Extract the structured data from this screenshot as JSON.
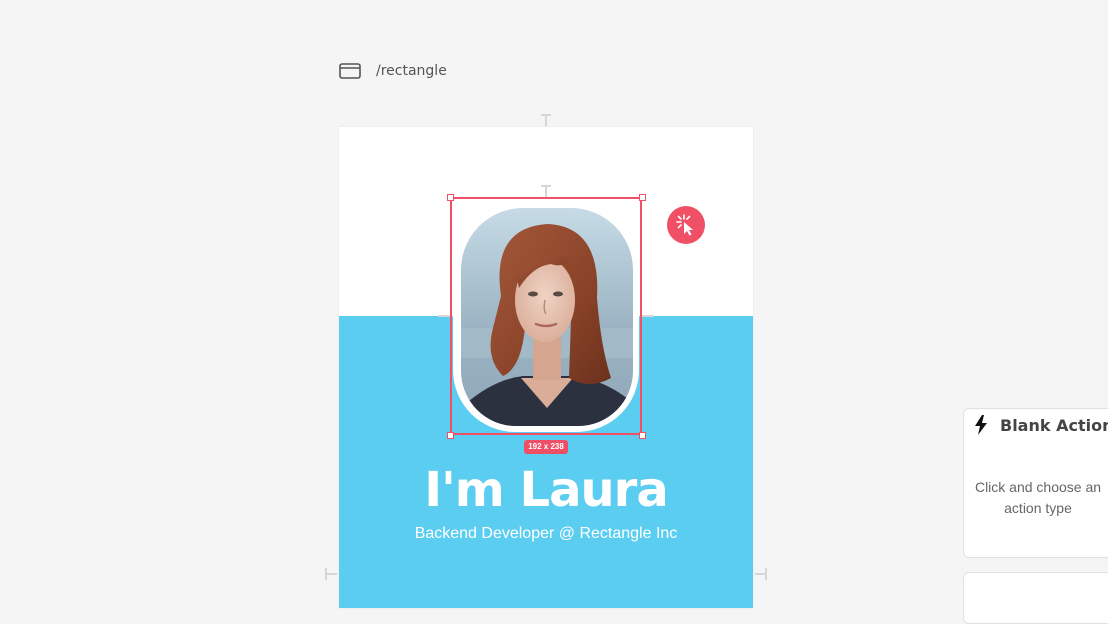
{
  "page": {
    "path": "/rectangle"
  },
  "hero": {
    "name": "I'm Laura",
    "subtitle": "Backend Developer @ Rectangle Inc"
  },
  "selection": {
    "size_label": "192 x 238"
  },
  "action_card": {
    "title": "Blank Action",
    "description": "Click and choose an action type"
  },
  "icons": {
    "page": "browser-window-icon",
    "interaction": "pointer-click-icon",
    "action": "lightning-bolt-icon"
  },
  "colors": {
    "accent": "#ef5066",
    "hero_background": "#5bcdf1",
    "canvas_background": "#f5f5f5"
  }
}
